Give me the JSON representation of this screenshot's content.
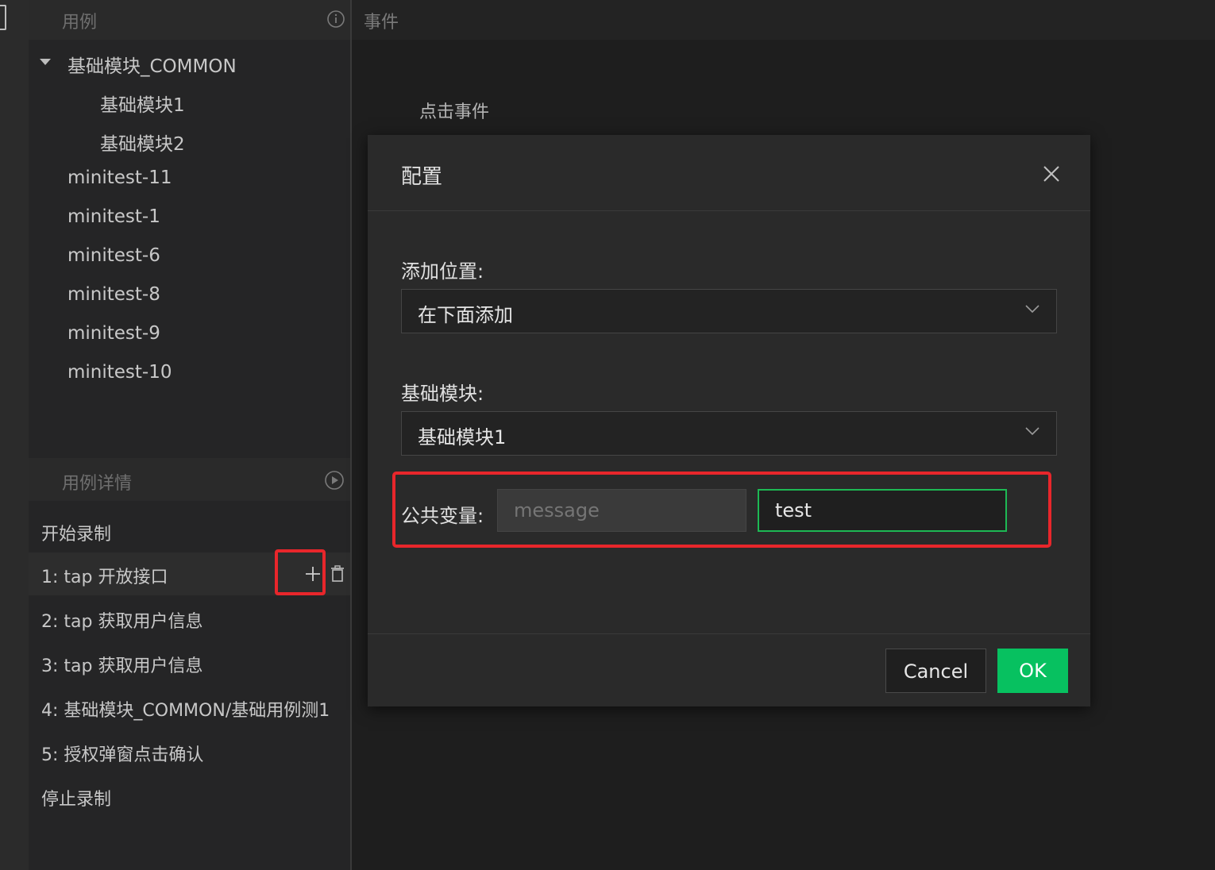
{
  "sidebar": {
    "cases_title": "用例",
    "tree": {
      "group": "基础模块_COMMON",
      "group_children": [
        "基础模块1",
        "基础模块2"
      ],
      "items": [
        "minitest-11",
        "minitest-1",
        "minitest-6",
        "minitest-8",
        "minitest-9",
        "minitest-10"
      ]
    },
    "details_title": "用例详情",
    "details": {
      "start": "开始录制",
      "steps": [
        "1: tap 开放接口",
        "2: tap 获取用户信息",
        "3: tap 获取用户信息",
        "4: 基础模块_COMMON/基础用例测1",
        "5: 授权弹窗点击确认"
      ],
      "stop": "停止录制"
    }
  },
  "main": {
    "header_title": "事件",
    "click_event_label": "点击事件"
  },
  "modal": {
    "title": "配置",
    "position_label": "添加位置:",
    "position_value": "在下面添加",
    "module_label": "基础模块:",
    "module_value": "基础模块1",
    "variable_label": "公共变量:",
    "variable_name_placeholder": "message",
    "variable_value": "test",
    "cancel_label": "Cancel",
    "ok_label": "OK"
  },
  "colors": {
    "accent_green": "#07c160",
    "highlight_red": "#e8262b",
    "focus_border": "#1db954"
  },
  "icons": [
    "info-icon",
    "play-circle-icon",
    "plus-icon",
    "trash-icon",
    "close-icon",
    "chevron-down-icon",
    "caret-down-icon"
  ]
}
